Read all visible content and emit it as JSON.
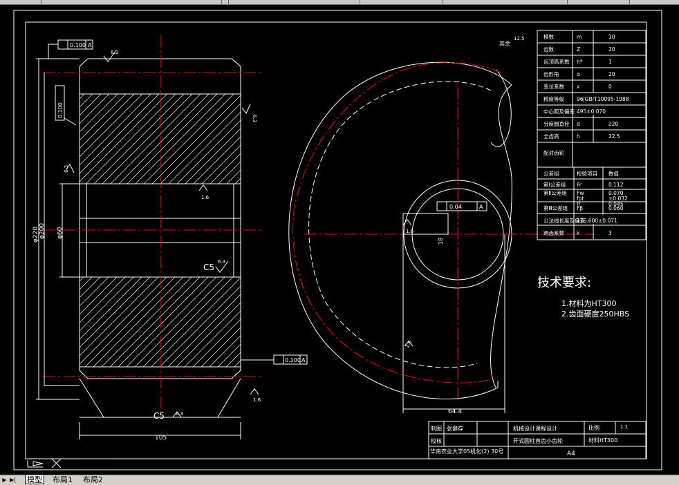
{
  "tabs": {
    "model": "模型",
    "layout1": "布局1",
    "layout2": "布局2"
  },
  "drawing": {
    "spec_table": [
      [
        "模数",
        "m",
        "10"
      ],
      [
        "齿数",
        "Z",
        "20"
      ],
      [
        "齿顶高系数",
        "h*",
        "1"
      ],
      [
        "齿形角",
        "α",
        "20"
      ],
      [
        "变位系数",
        "x",
        "0"
      ],
      [
        "精度等级",
        "96JGB/T10095-1988",
        ""
      ],
      [
        "中心距及偏差",
        "495±0.070",
        ""
      ],
      [
        "分度圆直径",
        "d",
        "220"
      ],
      [
        "全齿高",
        "h",
        "22.5"
      ],
      [
        "配对齿轮",
        "",
        ""
      ],
      [
        "公差组",
        "检验项目",
        "数值"
      ],
      [
        "第Ⅰ公差组",
        "Fr",
        "0.112"
      ],
      [
        "第Ⅱ公差组",
        "Fw",
        "0.070"
      ],
      [
        "",
        "fpt",
        "±0.032"
      ],
      [
        "",
        "fr",
        "0.045"
      ],
      [
        "第Ⅲ公差组",
        "Fβ",
        "0.060"
      ],
      [
        "公法线长度及偏差",
        "176.600±0.071",
        ""
      ],
      [
        "跨齿系数",
        "k",
        "3"
      ]
    ],
    "tech_title": "技术要求:",
    "tech_items": [
      "1.材料为HT300",
      "2.齿面硬度250HBS"
    ],
    "title_block": {
      "draw_label": "制图",
      "drawer": "张健存",
      "check_label": "校核",
      "course": "机械设计课程设计",
      "part_name": "开式圆柱直齿小齿轮",
      "scale_label": "比例",
      "scale": "1:1",
      "material": "材料HT300",
      "school": "华南农业大学05机化(2) 30号",
      "paper": "A4"
    },
    "dims": {
      "width": "105",
      "chamfer_top": "C5",
      "chamfer_bottom": "C5",
      "flatness": "0.04",
      "runout_a": "0.100",
      "runout_b": "0.100",
      "runout_c": "0.100",
      "datum": "A",
      "hub_width": "64.4",
      "bore_dia": "φ60",
      "outer_dia": "φ220",
      "root_dia": "φ200",
      "key_depth": "18",
      "rough_63": "6.3",
      "rough_16": "1.6",
      "rough_125": "12.5",
      "other_label": "其余"
    }
  },
  "colors": {
    "bg": "#000000",
    "line": "#ffffff",
    "center": "#ff0000"
  }
}
